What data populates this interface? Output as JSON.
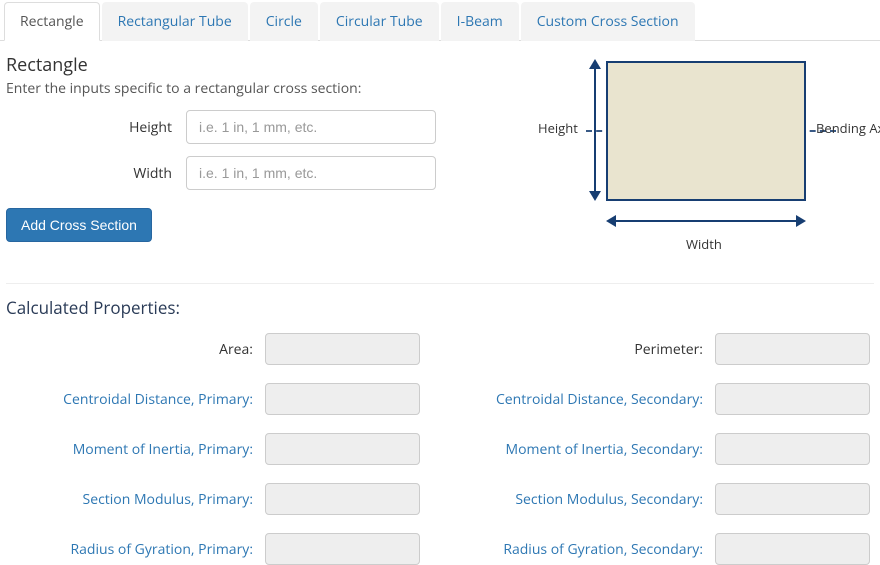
{
  "tabs": {
    "items": [
      {
        "label": "Rectangle",
        "active": true
      },
      {
        "label": "Rectangular Tube"
      },
      {
        "label": "Circle"
      },
      {
        "label": "Circular Tube"
      },
      {
        "label": "I-Beam"
      },
      {
        "label": "Custom Cross Section"
      }
    ]
  },
  "section": {
    "title": "Rectangle",
    "description": "Enter the inputs specific to a rectangular cross section:",
    "height_label": "Height",
    "width_label": "Width",
    "height_placeholder": "i.e. 1 in, 1 mm, etc.",
    "width_placeholder": "i.e. 1 in, 1 mm, etc.",
    "height_value": "",
    "width_value": "",
    "add_button": "Add Cross Section"
  },
  "diagram": {
    "height_label": "Height",
    "width_label": "Width",
    "bending_axis_label": "Bending Axis"
  },
  "calculated": {
    "title": "Calculated Properties:",
    "rows": [
      {
        "left_label": "Area:",
        "left_link": false,
        "left_value": "",
        "right_label": "Perimeter:",
        "right_link": false,
        "right_value": ""
      },
      {
        "left_label": "Centroidal Distance, Primary:",
        "left_link": true,
        "left_value": "",
        "right_label": "Centroidal Distance, Secondary:",
        "right_link": true,
        "right_value": ""
      },
      {
        "left_label": "Moment of Inertia, Primary:",
        "left_link": true,
        "left_value": "",
        "right_label": "Moment of Inertia, Secondary:",
        "right_link": true,
        "right_value": ""
      },
      {
        "left_label": "Section Modulus, Primary:",
        "left_link": true,
        "left_value": "",
        "right_label": "Section Modulus, Secondary:",
        "right_link": true,
        "right_value": ""
      },
      {
        "left_label": "Radius of Gyration, Primary:",
        "left_link": true,
        "left_value": "",
        "right_label": "Radius of Gyration, Secondary:",
        "right_link": true,
        "right_value": ""
      }
    ]
  }
}
